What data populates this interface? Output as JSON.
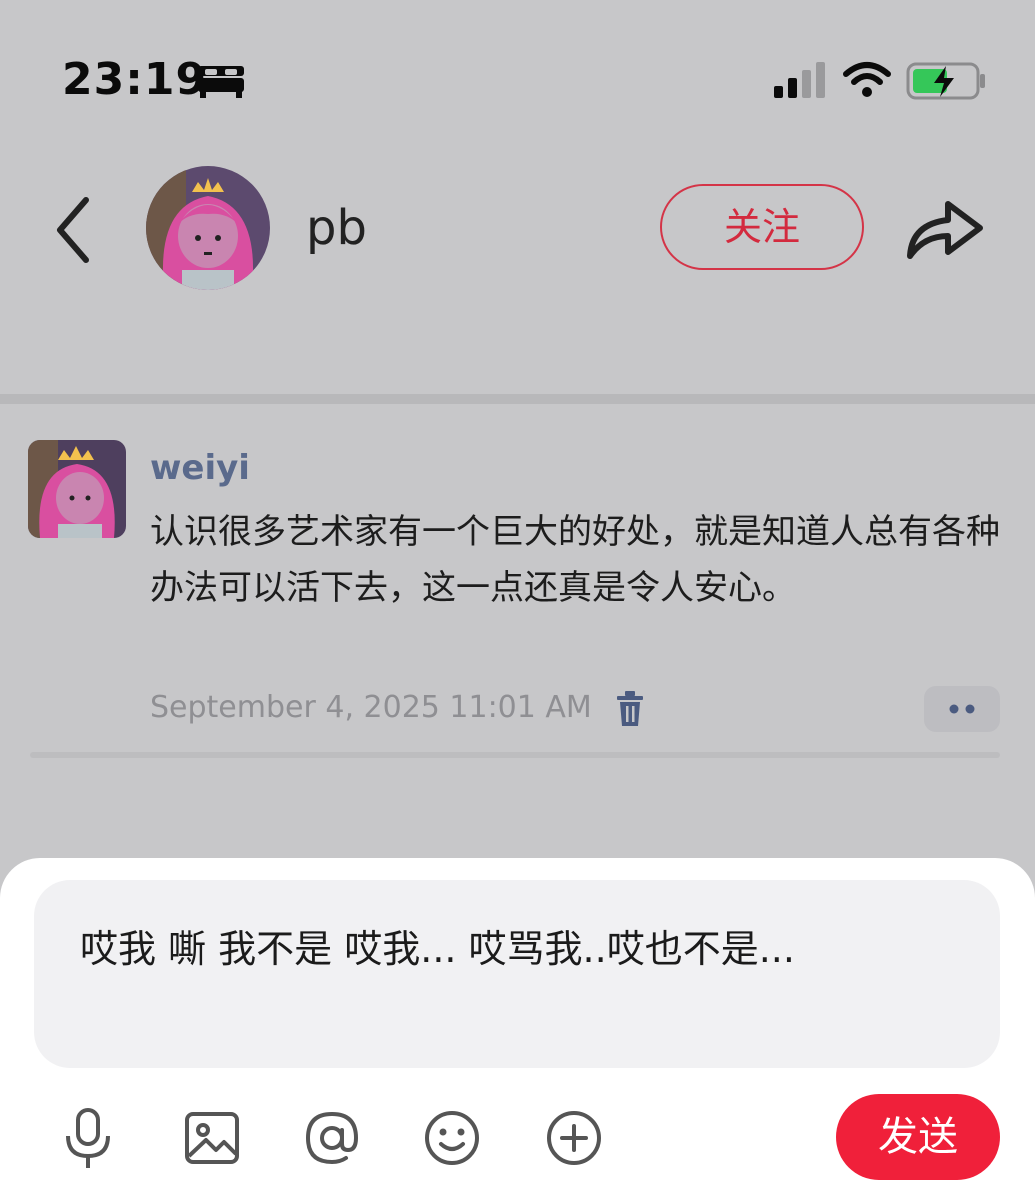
{
  "status_bar": {
    "time": "23:19",
    "icons": [
      "bed-icon",
      "signal-icon",
      "wifi-icon",
      "battery-charging-icon"
    ]
  },
  "header": {
    "back_icon": "chevron-left-icon",
    "profile_name": "pb",
    "follow_label": "关注",
    "share_icon": "share-arrow-icon",
    "accent_color": "#d32a3e"
  },
  "comment": {
    "username": "weiyi",
    "text": "认识很多艺术家有一个巨大的好处，就是知道人总有各种办法可以活下去，这一点还真是令人安心。",
    "timestamp": "September 4, 2025 11:01 AM",
    "delete_icon": "trash-icon",
    "more_icon": "more-dots-icon"
  },
  "composer": {
    "input_value": "哎我 嘶 我不是 哎我... 哎骂我..哎也不是...",
    "tools": [
      "microphone-icon",
      "image-icon",
      "at-icon",
      "emoji-icon",
      "plus-circle-icon"
    ],
    "send_label": "发送",
    "send_color": "#f0203a"
  }
}
